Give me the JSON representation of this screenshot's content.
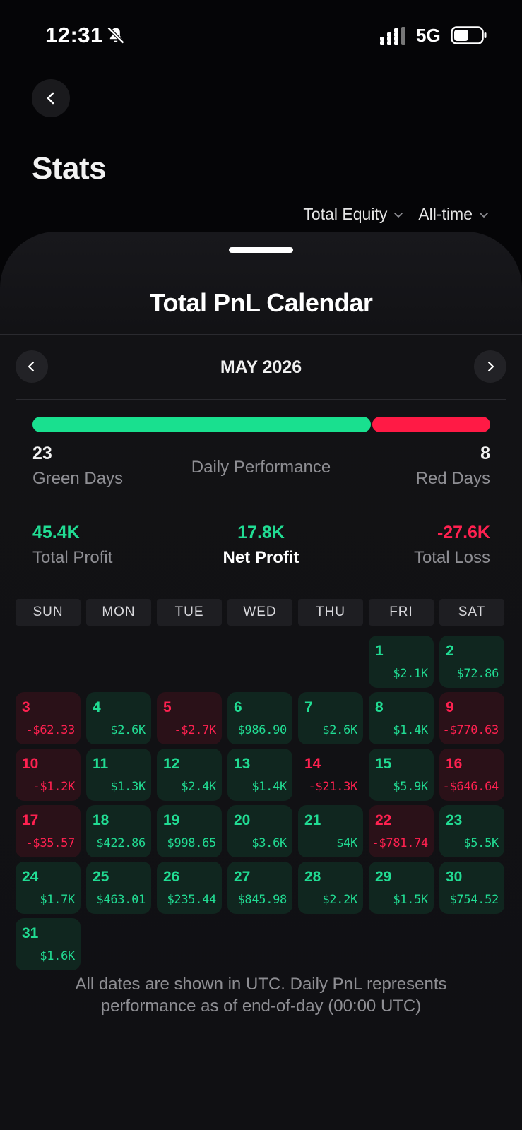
{
  "status_bar": {
    "time": "12:31",
    "network": "5G",
    "icons": [
      "bell-slash-icon",
      "signal-icon",
      "battery-icon"
    ]
  },
  "header": {
    "back_icon": "chevron-left-icon",
    "title": "Stats",
    "filters": [
      {
        "label": "Total Equity",
        "icon": "chevron-down-icon"
      },
      {
        "label": "All-time",
        "icon": "chevron-down-icon"
      }
    ]
  },
  "sheet": {
    "title": "Total PnL Calendar",
    "month": "MAY 2026",
    "prev_icon": "chevron-left-icon",
    "next_icon": "chevron-right-icon"
  },
  "performance": {
    "title": "Daily Performance",
    "green_days": "23",
    "green_label": "Green Days",
    "red_days": "8",
    "red_label": "Red Days",
    "green_fraction": 0.742
  },
  "summary": {
    "total_profit": "45.4K",
    "total_profit_label": "Total Profit",
    "net_profit": "17.8K",
    "net_profit_label": "Net Profit",
    "total_loss": "-27.6K",
    "total_loss_label": "Total Loss"
  },
  "weekdays": [
    "SUN",
    "MON",
    "TUE",
    "WED",
    "THU",
    "FRI",
    "SAT"
  ],
  "calendar": {
    "leading_blanks": 5,
    "days": [
      {
        "day": "1",
        "value": "$2.1K",
        "status": "green"
      },
      {
        "day": "2",
        "value": "$72.86",
        "status": "green"
      },
      {
        "day": "3",
        "value": "-$62.33",
        "status": "red"
      },
      {
        "day": "4",
        "value": "$2.6K",
        "status": "green"
      },
      {
        "day": "5",
        "value": "-$2.7K",
        "status": "red"
      },
      {
        "day": "6",
        "value": "$986.90",
        "status": "green"
      },
      {
        "day": "7",
        "value": "$2.6K",
        "status": "green"
      },
      {
        "day": "8",
        "value": "$1.4K",
        "status": "green"
      },
      {
        "day": "9",
        "value": "-$770.63",
        "status": "red"
      },
      {
        "day": "10",
        "value": "-$1.2K",
        "status": "red"
      },
      {
        "day": "11",
        "value": "$1.3K",
        "status": "green"
      },
      {
        "day": "12",
        "value": "$2.4K",
        "status": "green"
      },
      {
        "day": "13",
        "value": "$1.4K",
        "status": "green"
      },
      {
        "day": "14",
        "value": "-$21.3K",
        "status": "red-plain"
      },
      {
        "day": "15",
        "value": "$5.9K",
        "status": "green"
      },
      {
        "day": "16",
        "value": "-$646.64",
        "status": "red"
      },
      {
        "day": "17",
        "value": "-$35.57",
        "status": "red"
      },
      {
        "day": "18",
        "value": "$422.86",
        "status": "green"
      },
      {
        "day": "19",
        "value": "$998.65",
        "status": "green"
      },
      {
        "day": "20",
        "value": "$3.6K",
        "status": "green"
      },
      {
        "day": "21",
        "value": "$4K",
        "status": "green"
      },
      {
        "day": "22",
        "value": "-$781.74",
        "status": "red"
      },
      {
        "day": "23",
        "value": "$5.5K",
        "status": "green"
      },
      {
        "day": "24",
        "value": "$1.7K",
        "status": "green"
      },
      {
        "day": "25",
        "value": "$463.01",
        "status": "green"
      },
      {
        "day": "26",
        "value": "$235.44",
        "status": "green"
      },
      {
        "day": "27",
        "value": "$845.98",
        "status": "green"
      },
      {
        "day": "28",
        "value": "$2.2K",
        "status": "green"
      },
      {
        "day": "29",
        "value": "$1.5K",
        "status": "green"
      },
      {
        "day": "30",
        "value": "$754.52",
        "status": "green"
      },
      {
        "day": "31",
        "value": "$1.6K",
        "status": "green"
      }
    ]
  },
  "footnote": {
    "line1": "All dates are shown in UTC. Daily PnL represents",
    "line2": "performance as of end-of-day (00:00 UTC)"
  },
  "colors": {
    "green": "#21dc93",
    "red": "#ff2150",
    "background": "#050507"
  }
}
